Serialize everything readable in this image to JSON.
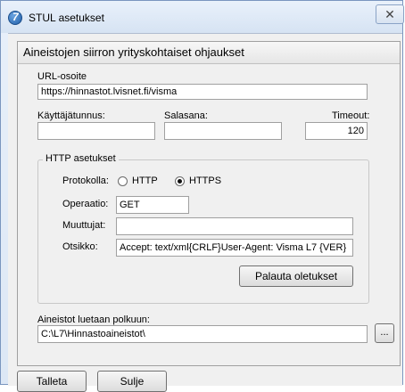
{
  "window": {
    "title": "STUL asetukset",
    "icon": "app-logo-icon"
  },
  "panel": {
    "title": "Aineistojen siirron yrityskohtaiset ohjaukset"
  },
  "url": {
    "label": "URL-osoite",
    "value": "https://hinnastot.lvisnet.fi/visma"
  },
  "username": {
    "label": "Käyttäjätunnus:",
    "value": ""
  },
  "password": {
    "label": "Salasana:",
    "value": ""
  },
  "timeout": {
    "label": "Timeout:",
    "value": "120"
  },
  "http": {
    "legend": "HTTP asetukset",
    "protocol_label": "Protokolla:",
    "protocol_options": [
      {
        "label": "HTTP",
        "selected": false
      },
      {
        "label": "HTTPS",
        "selected": true
      }
    ],
    "operation_label": "Operaatio:",
    "operation_value": "GET",
    "variables_label": "Muuttujat:",
    "variables_value": "",
    "headers_label": "Otsikko:",
    "headers_value": "Accept: text/xml{CRLF}User-Agent: Visma L7 {VER}",
    "reset_button": "Palauta oletukset"
  },
  "path": {
    "label": "Aineistot luetaan polkuun:",
    "value": "C:\\L7\\Hinnastoaineistot\\",
    "browse_button": "..."
  },
  "buttons": {
    "save": "Talleta",
    "close": "Sulje"
  }
}
